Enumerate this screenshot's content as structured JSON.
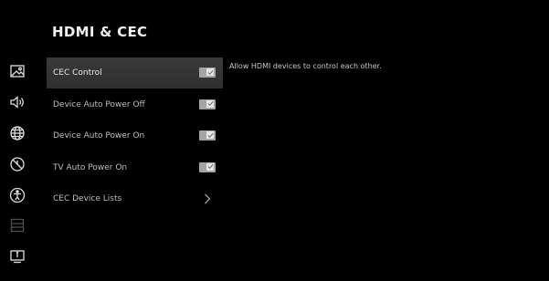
{
  "page": {
    "title": "HDMI & CEC"
  },
  "rail": {
    "icons": [
      {
        "name": "picture-icon"
      },
      {
        "name": "sound-icon"
      },
      {
        "name": "network-icon"
      },
      {
        "name": "timer-icon"
      },
      {
        "name": "accessibility-icon"
      },
      {
        "name": "channels-icon"
      },
      {
        "name": "system-info-icon"
      }
    ]
  },
  "menu": {
    "items": [
      {
        "label": "CEC Control",
        "type": "checkbox",
        "checked": true,
        "selected": true
      },
      {
        "label": "Device Auto Power Off",
        "type": "checkbox",
        "checked": true
      },
      {
        "label": "Device Auto Power On",
        "type": "checkbox",
        "checked": true
      },
      {
        "label": "TV Auto Power On",
        "type": "checkbox",
        "checked": true
      },
      {
        "label": "CEC Device Lists",
        "type": "link"
      }
    ]
  },
  "description": "Allow HDMI devices to control each other.",
  "colors": {
    "background": "#000000",
    "selected_row": "#353535",
    "checkbox": "#a5a5a5",
    "text": "#d8d8d8"
  }
}
